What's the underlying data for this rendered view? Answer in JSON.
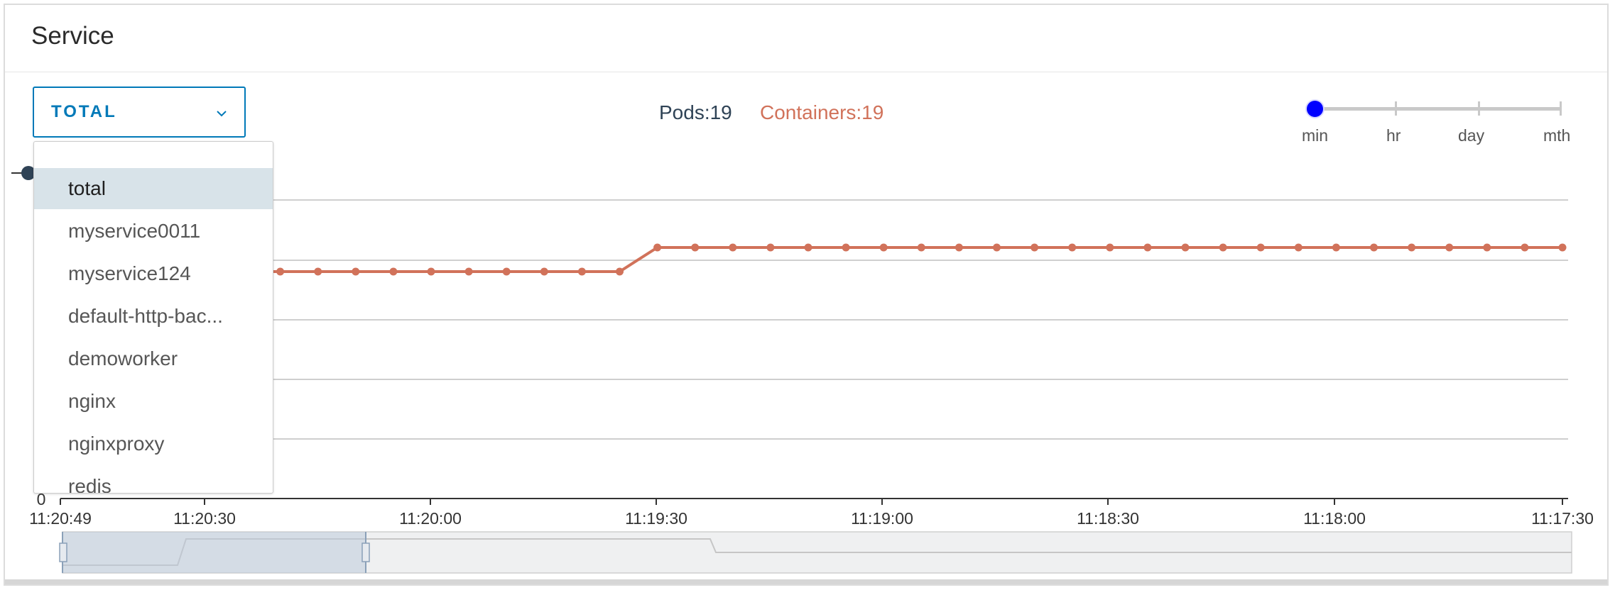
{
  "card": {
    "title": "Service"
  },
  "selector": {
    "value": "TOTAL"
  },
  "legend": {
    "pods": "Pods:19",
    "containers": "Containers:19"
  },
  "time_range": {
    "labels": [
      "min",
      "hr",
      "day",
      "mth"
    ],
    "selected": "min"
  },
  "dropdown": {
    "items": [
      "total",
      "myservice0011",
      "myservice124",
      "default-http-bac...",
      "demoworker",
      "nginx",
      "nginxproxy",
      "redis"
    ],
    "selected": "total"
  },
  "colors": {
    "accent": "#0079b8",
    "containers_series": "#d1725a",
    "pods_series": "#2f4356",
    "range_knob": "#0000ff",
    "gridline": "#cfcfcf"
  },
  "chart_data": {
    "type": "line",
    "y_zero_label": "0",
    "x_tick_labels": [
      "11:20:49",
      "11:20:30",
      "11:20:00",
      "11:19:30",
      "11:19:00",
      "11:18:30",
      "11:18:00",
      "11:17:30"
    ],
    "grid": true,
    "series": [
      {
        "name": "Containers:19",
        "color": "#d1725a",
        "first_values": 18,
        "last_values": 19
      }
    ],
    "point_count": 41,
    "step_after_point": 16,
    "navigator": true
  }
}
